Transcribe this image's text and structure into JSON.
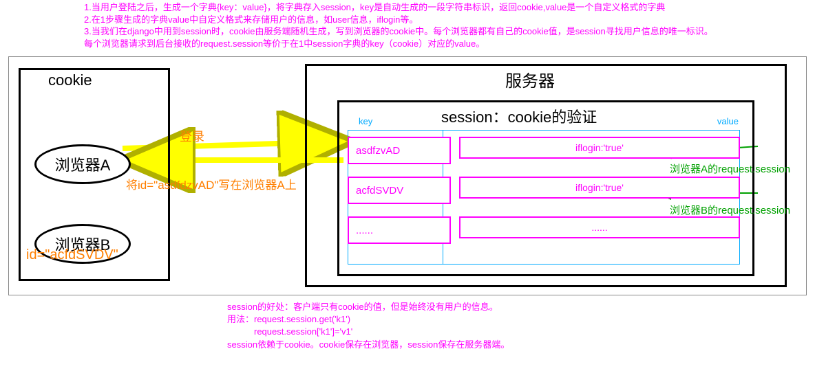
{
  "top": {
    "l1": "1.当用户登陆之后，生成一个字典{key：value}，将字典存入session，key是自动生成的一段字符串标识，返回cookie,value是一个自定义格式的字典",
    "l2": "2.在1步骤生成的字典value中自定义格式来存储用户的信息，如user信息，iflogin等。",
    "l3": "3.当我们在django中用到session时，cookie由服务端随机生成，写到浏览器的cookie中。每个浏览器都有自己的cookie值，是session寻找用户信息的唯一标识。",
    "l4": "每个浏览器请求到后台接收的request.session等价于在1中session字典的key（cookie）对应的value。"
  },
  "cookie": {
    "title": "cookie",
    "browserA": "浏览器A",
    "browserB": "浏览器B",
    "idB": "id=\"acfdSVDV\""
  },
  "server": {
    "title": "服务器",
    "session_title": "session：cookie的验证",
    "key_label": "key",
    "value_label": "value",
    "rows": [
      {
        "key": "asdfzvAD",
        "value": "iflogin:'true'"
      },
      {
        "key": "acfdSVDV",
        "value": "iflogin:'true'"
      },
      {
        "key": "......",
        "value": "......"
      }
    ]
  },
  "arrows": {
    "login": "登录",
    "write": "将id=\"asdfdzvAD\"写在浏览器A上",
    "rsA": "浏览器A的request.session",
    "rsB": "浏览器B的request.session"
  },
  "bottom": {
    "l1": "session的好处：客户端只有cookie的值，但是始终没有用户的信息。",
    "l2": "用法：request.session.get('k1')",
    "l3": "　　　request.session['k1']='v1'",
    "l4": "session依赖于cookie。cookie保存在浏览器，session保存在服务器端。"
  }
}
